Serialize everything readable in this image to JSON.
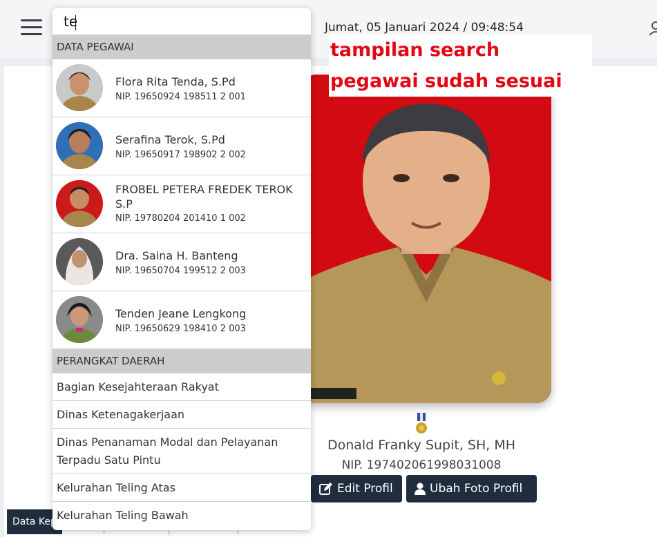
{
  "header": {
    "datetime": "Jumat, 05 Januari 2024 / 09:48:54"
  },
  "annotation": {
    "line1": "tampilan search",
    "line2": "pegawai sudah sesuai"
  },
  "profile": {
    "name": "Donald Franky Supit, SH, MH",
    "nip": "NIP. 197402061998031008",
    "edit_label": "Edit Profil",
    "photo_label": "Ubah Foto Profil"
  },
  "bottom": {
    "chip_label": "Data Kep"
  },
  "search": {
    "value": "te",
    "employees_header": "DATA PEGAWAI",
    "employees": [
      {
        "name": "Flora Rita Tenda, S.Pd",
        "nip": "NIP. 19650924 198511 2 001"
      },
      {
        "name": "Serafina Terok, S.Pd",
        "nip": "NIP. 19650917 198902 2 002"
      },
      {
        "name": "FROBEL PETERA FREDEK TEROK S.P",
        "nip": "NIP. 19780204 201410 1 002"
      },
      {
        "name": "Dra. Saina H. Banteng",
        "nip": "NIP. 19650704 199512 2 003"
      },
      {
        "name": "Tenden Jeane Lengkong",
        "nip": "NIP. 19650629 198410 2 003"
      }
    ],
    "departments_header": "PERANGKAT DAERAH",
    "departments": [
      "Bagian Kesejahteraan Rakyat",
      "Dinas Ketenagakerjaan",
      "Dinas Penanaman Modal dan Pelayanan Terpadu Satu Pintu",
      "Kelurahan Teling Atas",
      "Kelurahan Teling Bawah"
    ]
  },
  "colors": {
    "accent_dark": "#1f2d3d",
    "annotation_red": "#e30613",
    "photo_background": "#d20b12"
  }
}
